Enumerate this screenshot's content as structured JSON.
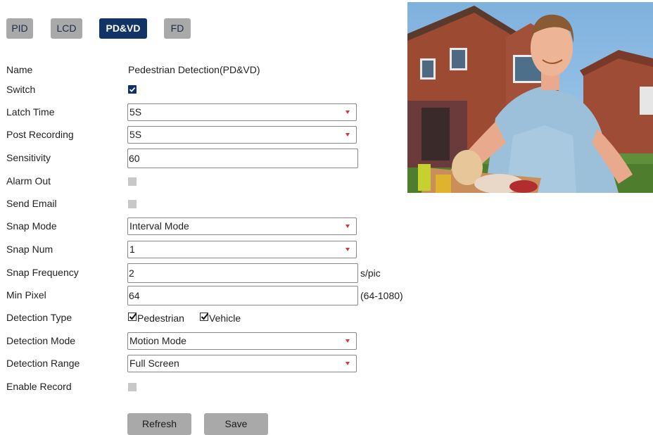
{
  "tabs": [
    {
      "label": "PID",
      "active": false
    },
    {
      "label": "LCD",
      "active": false
    },
    {
      "label": "PD&VD",
      "active": true
    },
    {
      "label": "FD",
      "active": false
    }
  ],
  "form": {
    "name": {
      "label": "Name",
      "value": "Pedestrian Detection(PD&VD)"
    },
    "switch": {
      "label": "Switch",
      "checked": true
    },
    "latch_time": {
      "label": "Latch Time",
      "value": "5S"
    },
    "post_recording": {
      "label": "Post Recording",
      "value": "5S"
    },
    "sensitivity": {
      "label": "Sensitivity",
      "value": "60"
    },
    "alarm_out": {
      "label": "Alarm Out",
      "checked": false
    },
    "send_email": {
      "label": "Send Email",
      "checked": false
    },
    "snap_mode": {
      "label": "Snap Mode",
      "value": "Interval Mode"
    },
    "snap_num": {
      "label": "Snap Num",
      "value": "1"
    },
    "snap_frequency": {
      "label": "Snap Frequency",
      "value": "2",
      "unit": "s/pic"
    },
    "min_pixel": {
      "label": "Min Pixel",
      "value": "64",
      "range": "(64-1080)"
    },
    "detection_type": {
      "label": "Detection Type",
      "options": [
        {
          "label": "Pedestrian",
          "checked": true
        },
        {
          "label": "Vehicle",
          "checked": true
        }
      ]
    },
    "detection_mode": {
      "label": "Detection Mode",
      "value": "Motion Mode"
    },
    "detection_range": {
      "label": "Detection Range",
      "value": "Full Screen"
    },
    "enable_record": {
      "label": "Enable Record",
      "checked": false
    }
  },
  "buttons": {
    "refresh": "Refresh",
    "save": "Save"
  },
  "colors": {
    "accent": "#113366",
    "tab_inactive": "#a9a9a9",
    "caret": "#d23a3a"
  },
  "icons": [
    "checkbox-checked-icon",
    "dropdown-caret-icon"
  ]
}
